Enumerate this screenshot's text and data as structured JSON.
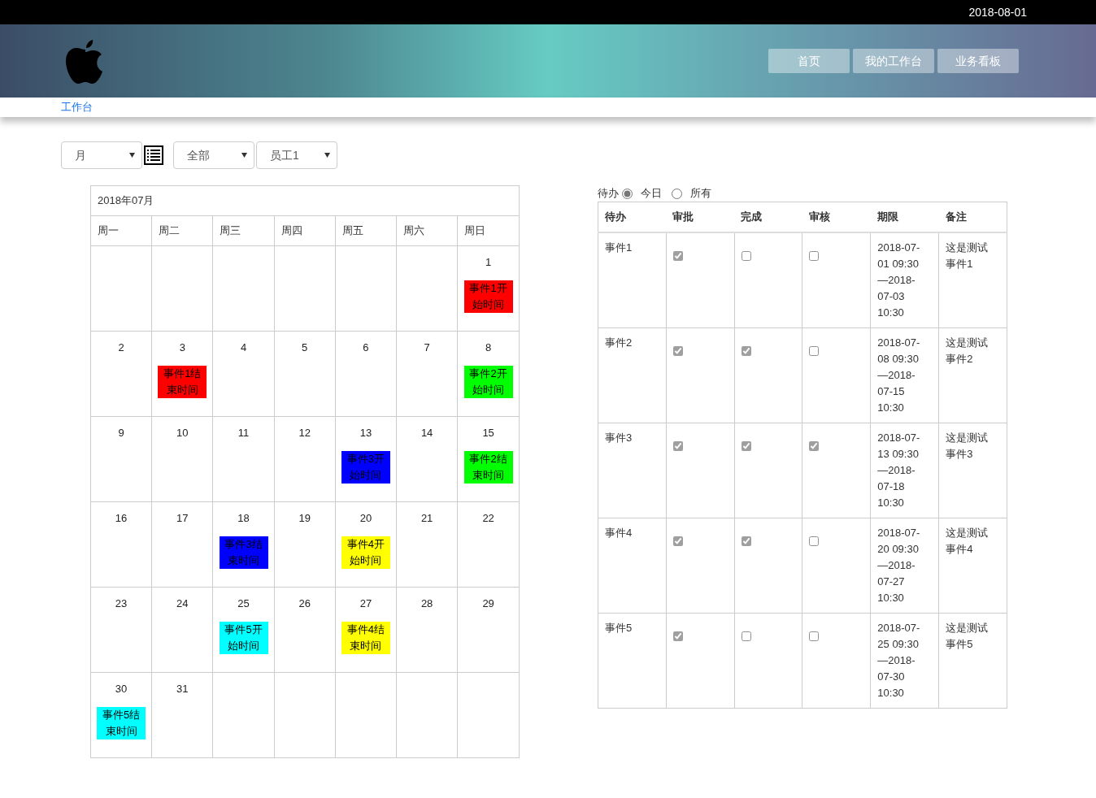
{
  "top_bar": {
    "date": "2018-08-01"
  },
  "nav_buttons": [
    {
      "label": "首页"
    },
    {
      "label": "我的工作台"
    },
    {
      "label": "业务看板"
    }
  ],
  "breadcrumb": "工作台",
  "filters": [
    {
      "value": "月"
    },
    {
      "value": "全部"
    },
    {
      "value": "员工1"
    }
  ],
  "calendar": {
    "title": "2018年07月",
    "weekdays": [
      "周一",
      "周二",
      "周三",
      "周四",
      "周五",
      "周六",
      "周日"
    ],
    "weeks": [
      [
        {
          "kind": "empty"
        },
        {
          "kind": "empty"
        },
        {
          "kind": "empty"
        },
        {
          "kind": "empty"
        },
        {
          "kind": "empty"
        },
        {
          "kind": "empty"
        },
        {
          "kind": "day",
          "day": "1",
          "events": [
            {
              "label": "事件1开始时间",
              "color": "#ff0000"
            }
          ]
        }
      ],
      [
        {
          "kind": "day",
          "day": "2"
        },
        {
          "kind": "day",
          "day": "3",
          "events": [
            {
              "label": "事件1结束时间",
              "color": "#ff0000"
            }
          ]
        },
        {
          "kind": "day",
          "day": "4"
        },
        {
          "kind": "day",
          "day": "5"
        },
        {
          "kind": "day",
          "day": "6"
        },
        {
          "kind": "day",
          "day": "7"
        },
        {
          "kind": "day",
          "day": "8",
          "events": [
            {
              "label": "事件2开始时间",
              "color": "#00ff00"
            }
          ]
        }
      ],
      [
        {
          "kind": "day",
          "day": "9"
        },
        {
          "kind": "day",
          "day": "10"
        },
        {
          "kind": "day",
          "day": "11"
        },
        {
          "kind": "day",
          "day": "12"
        },
        {
          "kind": "day",
          "day": "13",
          "events": [
            {
              "label": "事件3开始时间",
              "color": "#0000ff"
            }
          ]
        },
        {
          "kind": "day",
          "day": "14"
        },
        {
          "kind": "day",
          "day": "15",
          "events": [
            {
              "label": "事件2结束时间",
              "color": "#00ff00"
            }
          ]
        }
      ],
      [
        {
          "kind": "day",
          "day": "16"
        },
        {
          "kind": "day",
          "day": "17"
        },
        {
          "kind": "day",
          "day": "18",
          "events": [
            {
              "label": "事件3结束时间",
              "color": "#0000ff"
            }
          ]
        },
        {
          "kind": "day",
          "day": "19"
        },
        {
          "kind": "day",
          "day": "20",
          "events": [
            {
              "label": "事件4开始时间",
              "color": "#ffff00"
            }
          ]
        },
        {
          "kind": "day",
          "day": "21"
        },
        {
          "kind": "day",
          "day": "22"
        }
      ],
      [
        {
          "kind": "day",
          "day": "23"
        },
        {
          "kind": "day",
          "day": "24"
        },
        {
          "kind": "day",
          "day": "25",
          "events": [
            {
              "label": "事件5开始时间",
              "color": "#00ffff"
            }
          ]
        },
        {
          "kind": "day",
          "day": "26"
        },
        {
          "kind": "day",
          "day": "27",
          "events": [
            {
              "label": "事件4结束时间",
              "color": "#ffff00"
            }
          ]
        },
        {
          "kind": "day",
          "day": "28"
        },
        {
          "kind": "day",
          "day": "29"
        }
      ],
      [
        {
          "kind": "day",
          "day": "30",
          "events": [
            {
              "label": "事件5结束时间",
              "color": "#00ffff"
            }
          ]
        },
        {
          "kind": "day",
          "day": "31"
        },
        {
          "kind": "empty"
        },
        {
          "kind": "empty"
        },
        {
          "kind": "empty"
        },
        {
          "kind": "empty"
        },
        {
          "kind": "empty"
        }
      ]
    ]
  },
  "todo": {
    "label": "待办",
    "options": [
      {
        "label": "今日",
        "selected": true
      },
      {
        "label": "所有",
        "selected": false
      }
    ],
    "columns": [
      "待办",
      "审批",
      "完成",
      "审核",
      "期限",
      "备注"
    ],
    "rows": [
      {
        "name": "事件1",
        "approved": true,
        "done": false,
        "reviewed": false,
        "period": "2018-07-01 09:30—2018-07-03 10:30",
        "note": "这是测试事件1"
      },
      {
        "name": "事件2",
        "approved": true,
        "done": true,
        "reviewed": false,
        "period": "2018-07-08 09:30—2018-07-15 10:30",
        "note": "这是测试事件2"
      },
      {
        "name": "事件3",
        "approved": true,
        "done": true,
        "reviewed": true,
        "period": "2018-07-13 09:30—2018-07-18 10:30",
        "note": "这是测试事件3"
      },
      {
        "name": "事件4",
        "approved": true,
        "done": true,
        "reviewed": false,
        "period": "2018-07-20 09:30—2018-07-27 10:30",
        "note": "这是测试事件4"
      },
      {
        "name": "事件5",
        "approved": true,
        "done": false,
        "reviewed": false,
        "period": "2018-07-25 09:30—2018-07-30 10:30",
        "note": "这是测试事件5"
      }
    ]
  }
}
